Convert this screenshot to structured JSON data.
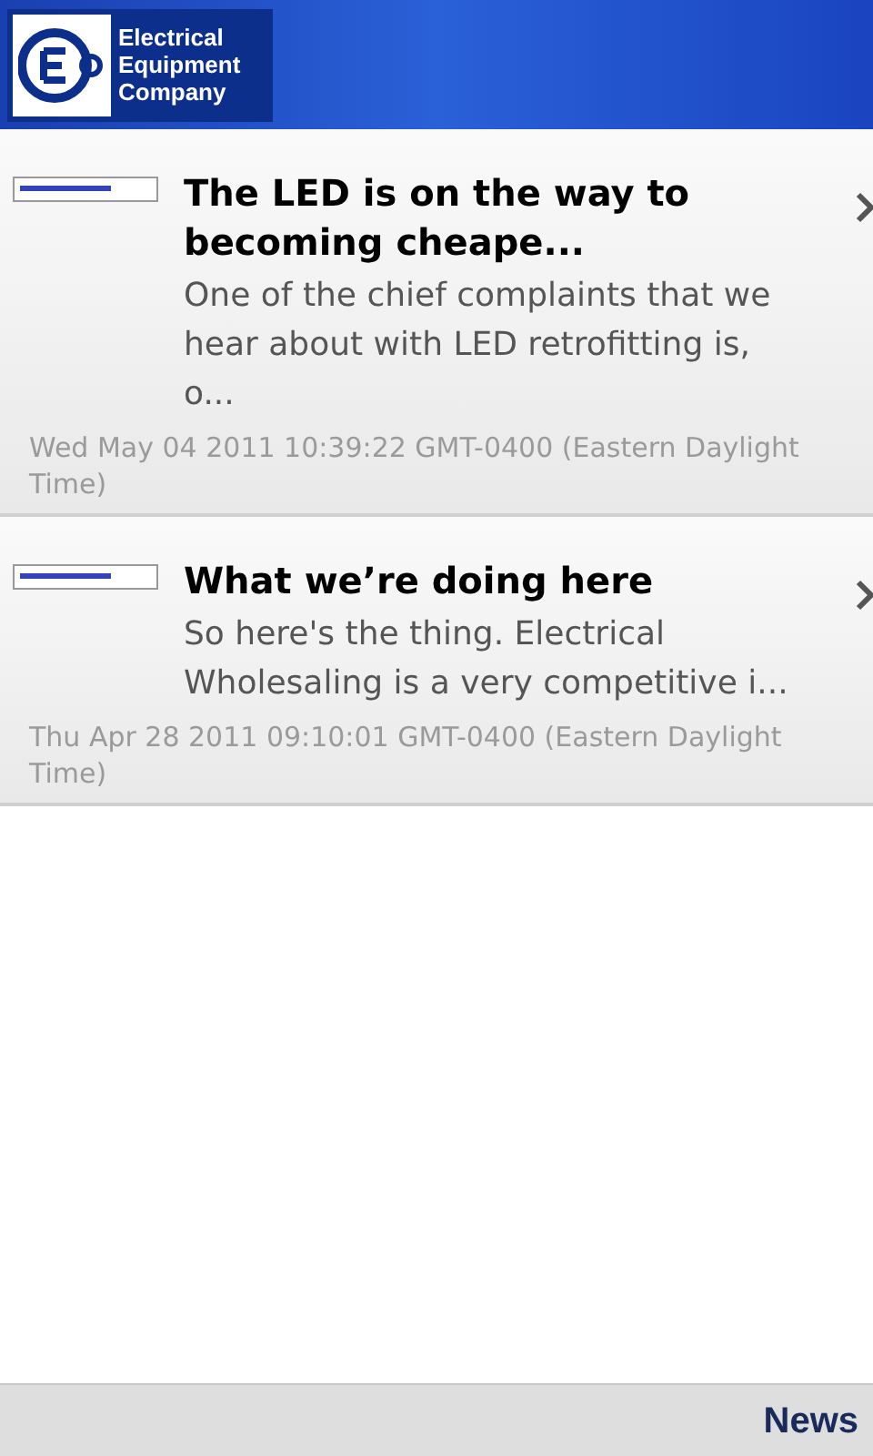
{
  "header": {
    "logo_lines": [
      "Electrical",
      "Equipment",
      "Company"
    ]
  },
  "articles": [
    {
      "title": "The LED is on the way to becoming cheape...",
      "summary": "One of the chief complaints that we hear about with LED retrofitting is, o...",
      "date": "Wed May 04 2011 10:39:22 GMT-0400 (Eastern Daylight Time)"
    },
    {
      "title": "What we’re doing here",
      "summary": "So here's the thing.  Electrical Wholesaling is a very competitive i...",
      "date": "Thu Apr 28 2011 09:10:01 GMT-0400 (Eastern Daylight Time)"
    }
  ],
  "footer": {
    "tab": "News"
  }
}
